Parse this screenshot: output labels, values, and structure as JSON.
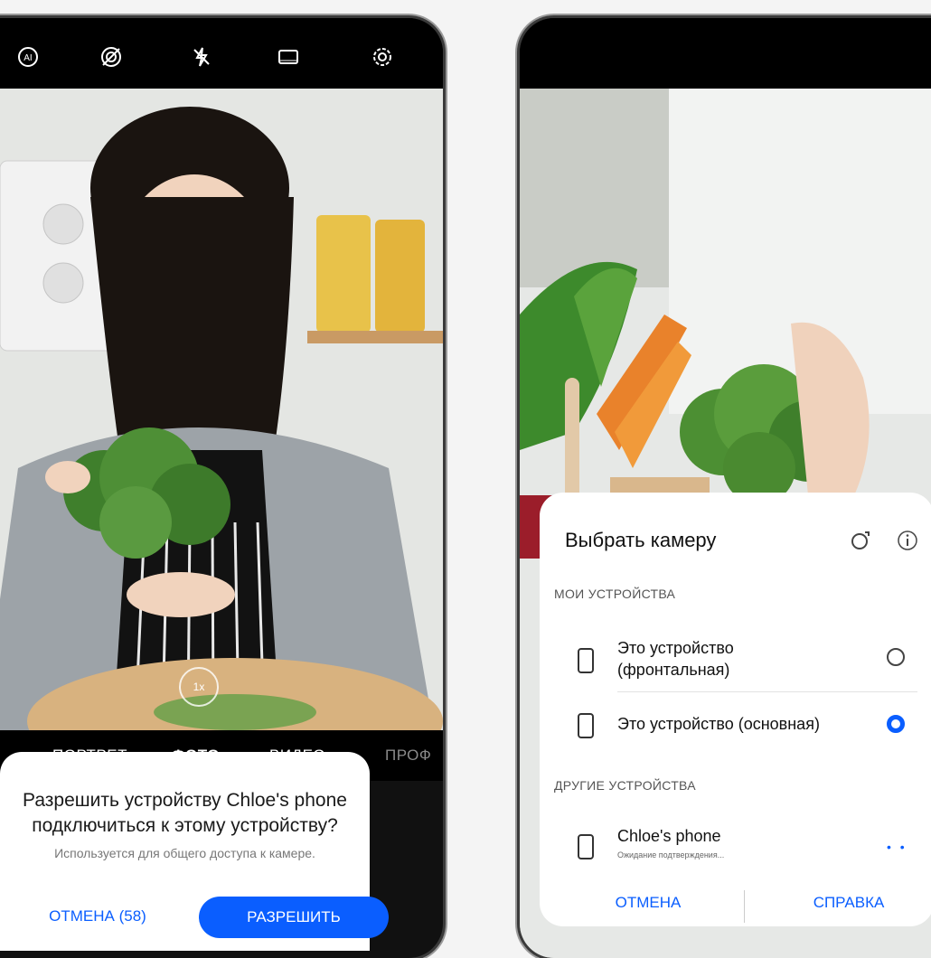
{
  "left_screen": {
    "camera_modes": [
      "ПОРТРЕТ",
      "ФОТО",
      "ВИДЕО",
      "ПРОФ"
    ],
    "active_mode": "ФОТО",
    "zoom_label": "1x",
    "dialog": {
      "title": "Разрешить устройству Chloe's phone подключиться к этому устройству?",
      "subtitle": "Используется для общего доступа к камере.",
      "cancel_label": "ОТМЕНА (58)",
      "allow_label": "РАЗРЕШИТЬ"
    }
  },
  "right_screen": {
    "dialog": {
      "title": "Выбрать камеру",
      "my_devices_header": "МОИ УСТРОЙСТВА",
      "devices": [
        {
          "label": "Это устройство (фронтальная)",
          "selected": false
        },
        {
          "label": "Это устройство (основная)",
          "selected": true
        }
      ],
      "other_devices_header": "ДРУГИЕ УСТРОЙСТВА",
      "other_devices": [
        {
          "name": "Chloe's phone",
          "status": "Ожидание подтверждения..."
        }
      ],
      "cancel_label": "ОТМЕНА",
      "help_label": "СПРАВКА"
    }
  },
  "colors": {
    "accent": "#0a5eff",
    "dialog_bg": "#ffffff",
    "camera_bar": "#000000"
  },
  "icons": [
    "ai-icon",
    "aperture-icon",
    "flash-off-icon",
    "aspect-ratio-icon",
    "settings-icon",
    "switch-camera-icon",
    "info-icon"
  ]
}
